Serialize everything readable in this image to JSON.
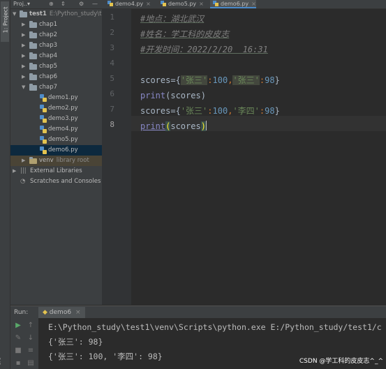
{
  "side_tabs": {
    "project": "1: Project",
    "structure": "ure"
  },
  "project_header": {
    "title": "Proj..▾"
  },
  "tree": {
    "root": {
      "name": "test1",
      "path": "E:\\Python_study\\te"
    },
    "folders": [
      "chap1",
      "chap2",
      "chap3",
      "chap4",
      "chap5",
      "chap6"
    ],
    "open_folder": "chap7",
    "files": [
      "demo1.py",
      "demo2.py",
      "demo3.py",
      "demo4.py",
      "demo5.py",
      "demo6.py"
    ],
    "venv": {
      "name": "venv",
      "note": "library root"
    },
    "external": "External Libraries",
    "scratches": "Scratches and Consoles"
  },
  "tabs": [
    {
      "label": "demo4.py"
    },
    {
      "label": "demo5.py"
    },
    {
      "label": "demo6.py"
    }
  ],
  "line_numbers": [
    "1",
    "2",
    "3",
    "4",
    "5",
    "6",
    "7",
    "8"
  ],
  "code": {
    "line1": "#地点：湖北武汉",
    "line2": "#姓名：学工科的皮皮志",
    "line3": "#开发时间：2022/2/20  16:31",
    "l5_var": "scores",
    "l5_eq": "=",
    "l5_open": "{",
    "l5_k1": "'张三'",
    "l5_c1": ":",
    "l5_v1": "100",
    "l5_comma": ",",
    "l5_k2": "'张三'",
    "l5_c2": ":",
    "l5_v2": "98",
    "l5_close": "}",
    "l6_fn": "print",
    "l6_arg": "(scores)",
    "l7_var": "scores",
    "l7_eq": "=",
    "l7_open": "{",
    "l7_k1": "'张三'",
    "l7_c1": ":",
    "l7_v1": "100",
    "l7_comma": ",",
    "l7_k2": "'李四'",
    "l7_c2": ":",
    "l7_v2": "98",
    "l7_close": "}",
    "l8_fn": "print",
    "l8_lp": "(",
    "l8_arg": "scores",
    "l8_rp": ")"
  },
  "run": {
    "label": "Run:",
    "tab": "demo6",
    "console": [
      "E:\\Python_study\\test1\\venv\\Scripts\\python.exe E:/Python_study/test1/c",
      "{'张三': 98}",
      "{'张三': 100, '李四': 98}"
    ]
  },
  "watermark": "CSDN @学工科的皮皮志^_^",
  "colors": {
    "editor_bg": "#2b2b2b",
    "panel_bg": "#3c3f41",
    "comment": "#808080",
    "string": "#6a8759",
    "number": "#6897bb",
    "keyword": "#cc7832",
    "builtin": "#8888c6",
    "selection": "#0d293e"
  },
  "icons": [
    "project-view-icon",
    "gear-icon",
    "collapse-icon",
    "run-icon",
    "stop-icon",
    "python-file-icon",
    "folder-icon"
  ]
}
